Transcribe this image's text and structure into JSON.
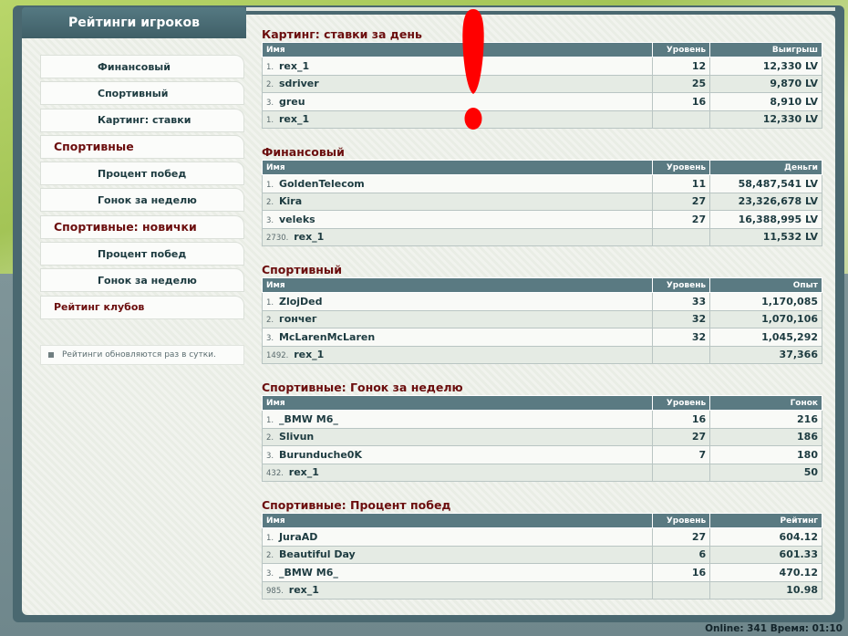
{
  "sidebar": {
    "title": "Рейтинги игроков",
    "items": [
      {
        "label": "Финансовый",
        "kind": "item"
      },
      {
        "label": "Спортивный",
        "kind": "item"
      },
      {
        "label": "Картинг: ставки",
        "kind": "item"
      },
      {
        "label": "Спортивные",
        "kind": "section"
      },
      {
        "label": "Процент побед",
        "kind": "item"
      },
      {
        "label": "Гонок за неделю",
        "kind": "item"
      },
      {
        "label": "Спортивные: новички",
        "kind": "section"
      },
      {
        "label": "Процент побед",
        "kind": "item"
      },
      {
        "label": "Гонок за неделю",
        "kind": "item"
      },
      {
        "label": "Рейтинг клубов",
        "kind": "club"
      }
    ],
    "note": "Рейтинги обновляются раз в сутки."
  },
  "columns": {
    "name": "Имя",
    "level": "Уровень"
  },
  "sections": [
    {
      "title": "Картинг: ставки за день",
      "value_header": "Выигрыш",
      "rows": [
        {
          "rank": "1.",
          "name": "rex_1",
          "level": "12",
          "value": "12,330 LV"
        },
        {
          "rank": "2.",
          "name": "sdriver",
          "level": "25",
          "value": "9,870 LV"
        },
        {
          "rank": "3.",
          "name": "greu",
          "level": "16",
          "value": "8,910 LV"
        },
        {
          "rank": "1.",
          "name": "rex_1",
          "level": "",
          "value": "12,330 LV"
        }
      ]
    },
    {
      "title": "Финансовый",
      "value_header": "Деньги",
      "rows": [
        {
          "rank": "1.",
          "name": "GoldenTelecom",
          "level": "11",
          "value": "58,487,541 LV"
        },
        {
          "rank": "2.",
          "name": "Kira",
          "level": "27",
          "value": "23,326,678 LV"
        },
        {
          "rank": "3.",
          "name": "veleks",
          "level": "27",
          "value": "16,388,995 LV"
        },
        {
          "rank": "2730.",
          "name": "rex_1",
          "level": "",
          "value": "11,532 LV"
        }
      ]
    },
    {
      "title": "Спортивный",
      "value_header": "Опыт",
      "rows": [
        {
          "rank": "1.",
          "name": "ZlojDed",
          "level": "33",
          "value": "1,170,085"
        },
        {
          "rank": "2.",
          "name": "гончег",
          "level": "32",
          "value": "1,070,106"
        },
        {
          "rank": "3.",
          "name": "McLarenMcLaren",
          "level": "32",
          "value": "1,045,292"
        },
        {
          "rank": "1492.",
          "name": "rex_1",
          "level": "",
          "value": "37,366"
        }
      ]
    },
    {
      "title": "Спортивные: Гонок за неделю",
      "value_header": "Гонок",
      "rows": [
        {
          "rank": "1.",
          "name": "_BMW M6_",
          "level": "16",
          "value": "216"
        },
        {
          "rank": "2.",
          "name": "Slivun",
          "level": "27",
          "value": "186"
        },
        {
          "rank": "3.",
          "name": "Burunduche0K",
          "level": "7",
          "value": "180"
        },
        {
          "rank": "432.",
          "name": "rex_1",
          "level": "",
          "value": "50"
        }
      ]
    },
    {
      "title": "Спортивные: Процент побед",
      "value_header": "Рейтинг",
      "rows": [
        {
          "rank": "1.",
          "name": "JuraAD",
          "level": "27",
          "value": "604.12"
        },
        {
          "rank": "2.",
          "name": "Beautiful Day",
          "level": "6",
          "value": "601.33"
        },
        {
          "rank": "3.",
          "name": "_BMW M6_",
          "level": "16",
          "value": "470.12"
        },
        {
          "rank": "985.",
          "name": "rex_1",
          "level": "",
          "value": "10.98"
        }
      ]
    }
  ],
  "footer": {
    "text": "Online: 341  Время: 01:10"
  },
  "colors": {
    "accent": "#6b0d0d",
    "header_bg": "#5a7a82",
    "exclamation": "#ff0000"
  },
  "annotation_icon": "exclamation-mark-icon"
}
